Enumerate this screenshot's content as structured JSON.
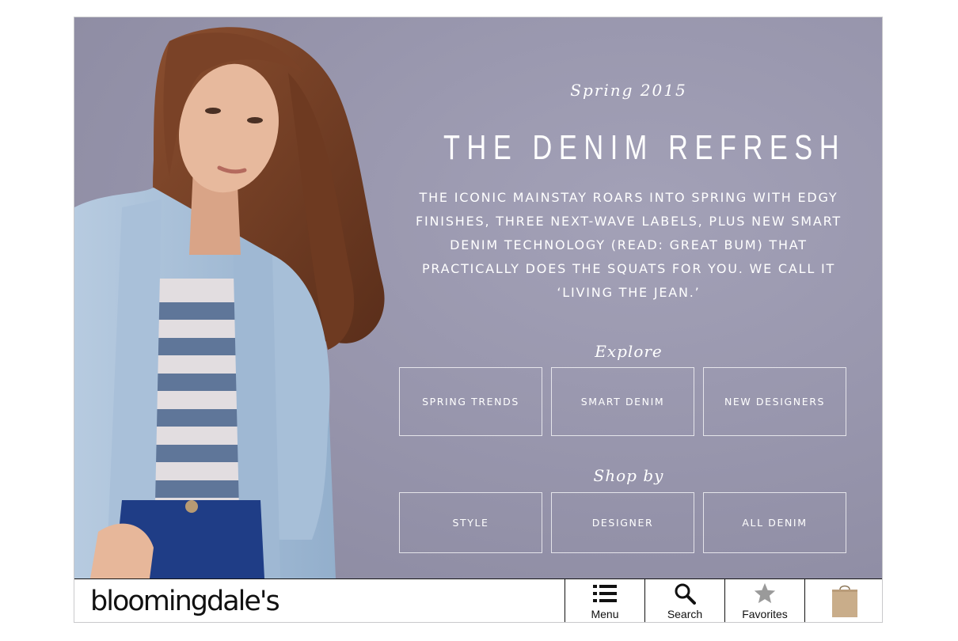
{
  "hero": {
    "season": "Spring 2015",
    "headline": "THE DENIM REFRESH",
    "body": "THE ICONIC MAINSTAY ROARS INTO SPRING WITH EDGY FINISHES, THREE NEXT-WAVE LABELS, PLUS NEW SMART DENIM TECHNOLOGY (READ: GREAT BUM) THAT PRACTICALLY DOES THE SQUATS FOR YOU. WE CALL IT ‘LIVING THE JEAN.’",
    "explore": {
      "label": "Explore",
      "buttons": [
        "SPRING TRENDS",
        "SMART DENIM",
        "NEW DESIGNERS"
      ]
    },
    "shop_by": {
      "label": "Shop by",
      "buttons": [
        "STYLE",
        "DESIGNER",
        "ALL DENIM"
      ]
    }
  },
  "navbar": {
    "logo": "bloomingdale's",
    "items": [
      {
        "label": "Menu",
        "icon": "menu-icon"
      },
      {
        "label": "Search",
        "icon": "search-icon"
      },
      {
        "label": "Favorites",
        "icon": "star-icon"
      },
      {
        "label": "",
        "icon": "shopping-bag-icon"
      }
    ]
  },
  "colors": {
    "hero_background": "#9896ad",
    "text_on_hero": "#ffffff",
    "bag": "#c9ad8a",
    "star": "#9a9a9a"
  }
}
